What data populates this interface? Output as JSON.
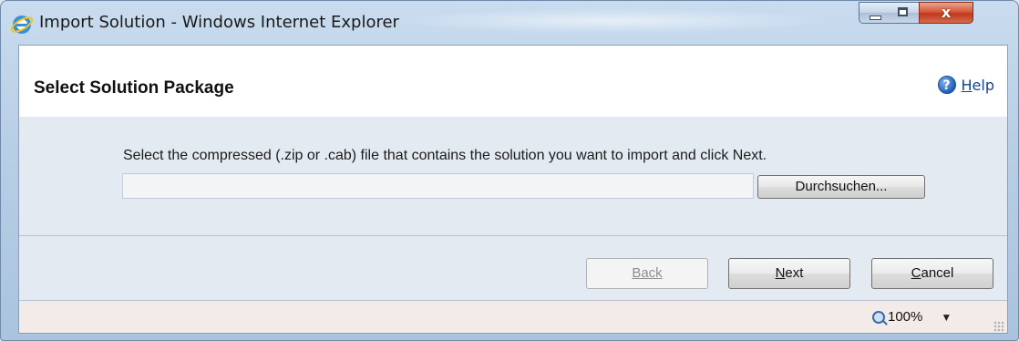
{
  "window": {
    "title": "Import Solution - Windows Internet Explorer",
    "close_glyph": "x"
  },
  "header": {
    "title": "Select Solution Package",
    "help_label": "Help"
  },
  "body": {
    "instruction": "Select the compressed (.zip or .cab) file that contains the solution you want to import and click Next.",
    "file_value": "",
    "browse_label": "Durchsuchen..."
  },
  "footer": {
    "back_label": "Back",
    "next_label": "Next",
    "cancel_label": "Cancel",
    "back_enabled": false
  },
  "status": {
    "zoom": "100%"
  },
  "colors": {
    "accent": "#15428b",
    "body_bg": "#e3eaf2",
    "close_red": "#c0391b"
  },
  "icons": {
    "app": "ie-icon",
    "help": "help-icon",
    "zoom": "zoom-icon"
  }
}
